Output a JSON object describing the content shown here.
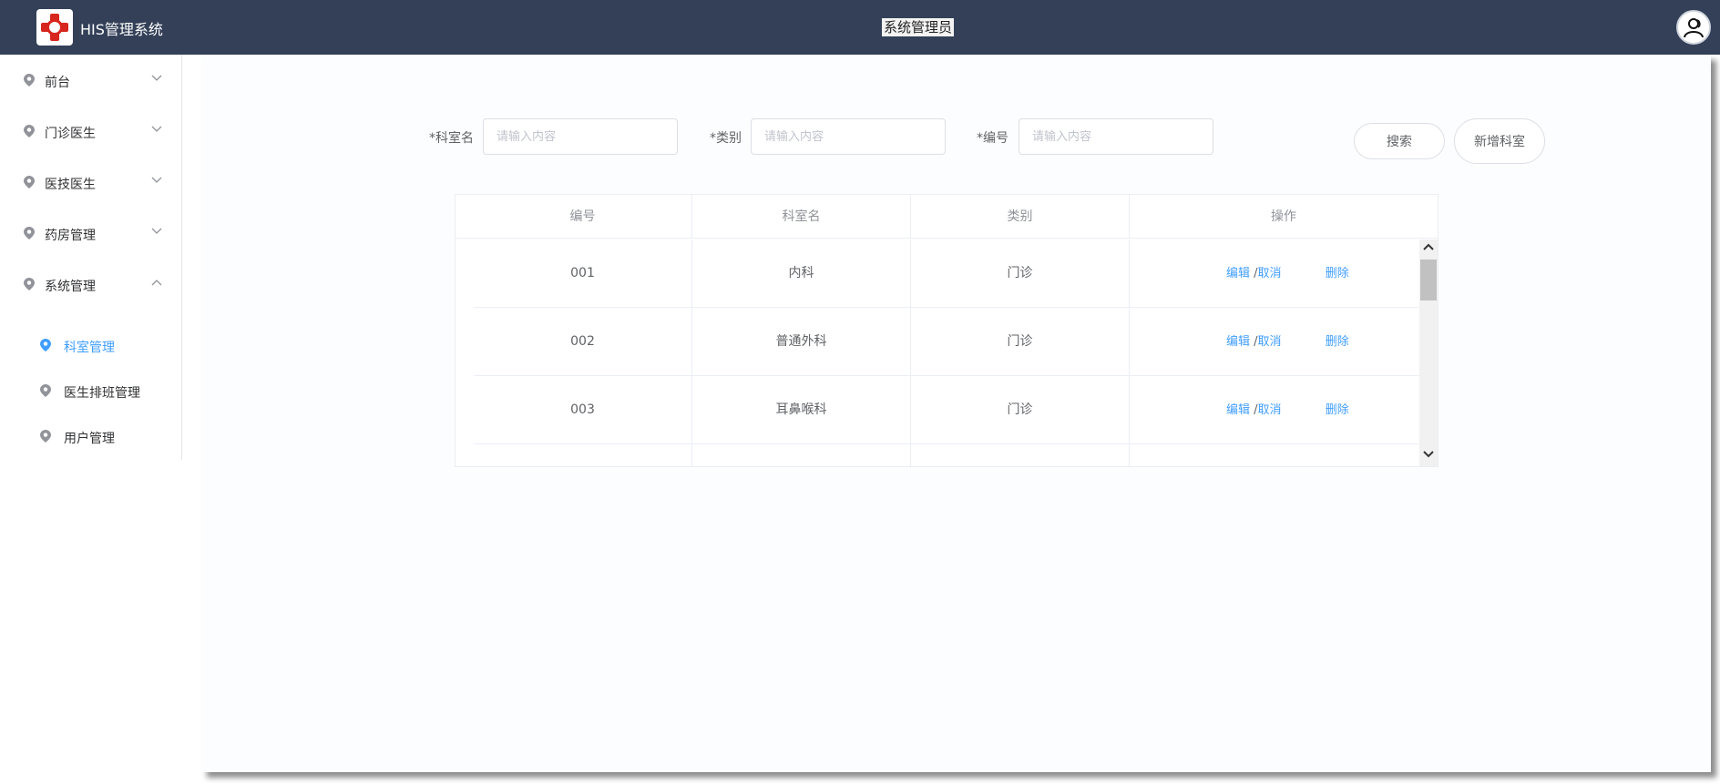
{
  "header": {
    "app_title": "HIS管理系统",
    "user_role": "系统管理员"
  },
  "sidebar": {
    "items": [
      {
        "label": "前台"
      },
      {
        "label": "门诊医生"
      },
      {
        "label": "医技医生"
      },
      {
        "label": "药房管理"
      },
      {
        "label": "系统管理"
      }
    ],
    "submenu": [
      {
        "label": "科室管理",
        "active": true
      },
      {
        "label": "医生排班管理",
        "active": false
      },
      {
        "label": "用户管理",
        "active": false
      }
    ]
  },
  "filters": {
    "dept_name_label": "*科室名",
    "category_label": "*类别",
    "code_label": "*编号",
    "placeholder": "请输入内容"
  },
  "buttons": {
    "search": "搜索",
    "add_dept": "新增科室"
  },
  "table": {
    "columns": [
      "编号",
      "科室名",
      "类别",
      "操作"
    ],
    "rows": [
      {
        "code": "001",
        "name": "内科",
        "category": "门诊"
      },
      {
        "code": "002",
        "name": "普通外科",
        "category": "门诊"
      },
      {
        "code": "003",
        "name": "耳鼻喉科",
        "category": "门诊"
      }
    ],
    "actions": {
      "edit": "编辑",
      "slash": "/",
      "cancel": "取消",
      "delete": "删除"
    }
  },
  "colors": {
    "header_bg": "#334058",
    "accent": "#409eff",
    "logo_red": "#d7261d"
  }
}
